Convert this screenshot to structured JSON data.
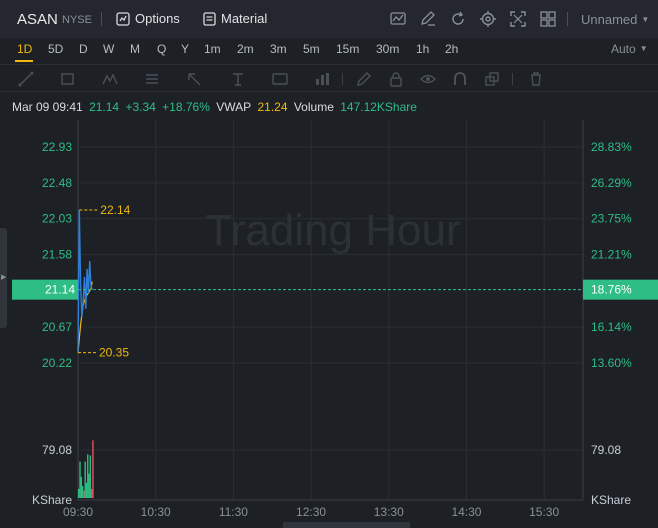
{
  "header": {
    "ticker": "ASAN",
    "exchange": "NYSE",
    "options_label": "Options",
    "material_label": "Material",
    "layout_name": "Unnamed",
    "icons": [
      "chart-style-icon",
      "drawing-icon",
      "refresh-icon",
      "settings-icon",
      "fullscreen-icon",
      "layout-grid-icon"
    ]
  },
  "timeframes": {
    "items": [
      "1D",
      "5D",
      "D",
      "W",
      "M",
      "Q",
      "Y",
      "1m",
      "2m",
      "3m",
      "5m",
      "15m",
      "30m",
      "1h",
      "2h"
    ],
    "active": "1D",
    "scale_mode": "Auto"
  },
  "info": {
    "datetime": "Mar 09 09:41",
    "price": "21.14",
    "change": "+3.34",
    "change_pct": "+18.76%",
    "vwap_label": "VWAP",
    "vwap": "21.24",
    "volume_label": "Volume",
    "volume": "147.12KShare"
  },
  "chart_data": {
    "type": "line",
    "watermark": "Trading Hour",
    "price_ticks": [
      22.93,
      22.48,
      22.03,
      21.58,
      20.67,
      20.22
    ],
    "pct_ticks": [
      "28.83%",
      "26.29%",
      "23.75%",
      "21.21%",
      "16.14%",
      "13.60%"
    ],
    "current_price": "21.14",
    "current_pct": "18.76%",
    "high_marker": "22.14",
    "low_marker": "20.35",
    "volume_tick": "79.08",
    "volume_unit": "KShare",
    "x_ticks": [
      "09:30",
      "10:30",
      "11:30",
      "12:30",
      "13:30",
      "14:30",
      "15:30"
    ],
    "price_series": {
      "time_min": [
        0,
        1,
        2,
        3,
        4,
        5,
        6,
        7,
        8,
        9,
        10,
        11
      ],
      "price": [
        20.35,
        22.14,
        21.2,
        20.8,
        21.0,
        21.3,
        20.9,
        21.4,
        21.1,
        21.5,
        21.2,
        21.14
      ],
      "color": "#2f7fd8"
    },
    "vwap_series": {
      "time_min": [
        0,
        2,
        4,
        6,
        8,
        10,
        11
      ],
      "price": [
        20.35,
        20.7,
        20.95,
        21.05,
        21.1,
        21.15,
        21.24
      ],
      "color": "#f0b90b"
    },
    "volume_bars": {
      "time_min": [
        0,
        1,
        2,
        3,
        4,
        5,
        6,
        7,
        8,
        9,
        10,
        11
      ],
      "volume": [
        15,
        60,
        35,
        20,
        12,
        60,
        25,
        72,
        40,
        70,
        15,
        95
      ],
      "colors": [
        "#2ebd85",
        "#2ebd85",
        "#2ebd85",
        "#2ebd85",
        "#ef4d5c",
        "#2ebd85",
        "#2ebd85",
        "#2ebd85",
        "#2ebd85",
        "#2ebd85",
        "#ef4d5c",
        "#ef4d5c"
      ]
    },
    "grid": true,
    "colors": {
      "up": "#2ebd85",
      "down": "#ef4d5c",
      "accent": "#f0b90b",
      "background": "#1d2126"
    }
  }
}
